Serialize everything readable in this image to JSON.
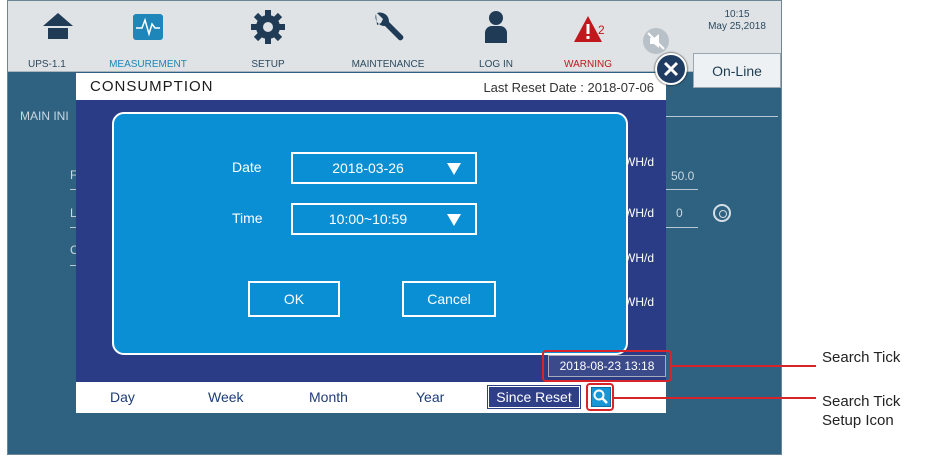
{
  "header": {
    "device": "UPS-1.1",
    "nav": [
      {
        "label": "",
        "icon": "home-icon"
      },
      {
        "label": "MEASUREMENT",
        "icon": "waveform-icon"
      },
      {
        "label": "SETUP",
        "icon": "gear-icon"
      },
      {
        "label": "MAINTENANCE",
        "icon": "wrench-icon"
      },
      {
        "label": "LOG IN",
        "icon": "user-icon"
      },
      {
        "label": "WARNING",
        "icon": "warning-icon",
        "count": "2"
      },
      {
        "label": "",
        "icon": "mute-icon"
      }
    ],
    "time": "10:15",
    "date": "May 25,2018",
    "status": "On-Line"
  },
  "background": {
    "section": "MAIN INI",
    "row_letters": [
      "F",
      "L",
      "C"
    ],
    "value_a": "50.0",
    "value_b": "0"
  },
  "dialog": {
    "title": "CONSUMPTION",
    "last_reset": "Last Reset Date : 2018-07-06",
    "date_label": "Date",
    "date_value": "2018-03-26",
    "time_label": "Time",
    "time_value": "10:00~10:59",
    "ok_label": "OK",
    "cancel_label": "Cancel",
    "unit": "WH/d",
    "search_tick": "2018-08-23 13:18",
    "tabs": [
      "Day",
      "Week",
      "Month",
      "Year",
      "Since Reset"
    ]
  },
  "callouts": {
    "search_tick": "Search Tick",
    "search_icon_line1": "Search Tick",
    "search_icon_line2": "Setup Icon"
  },
  "colors": {
    "screen_bg": "#2f6280",
    "dialog_bg": "#2b3c86",
    "popup_bg": "#0a8fd4",
    "highlight": "#d9232a",
    "warning": "#c0181c"
  }
}
